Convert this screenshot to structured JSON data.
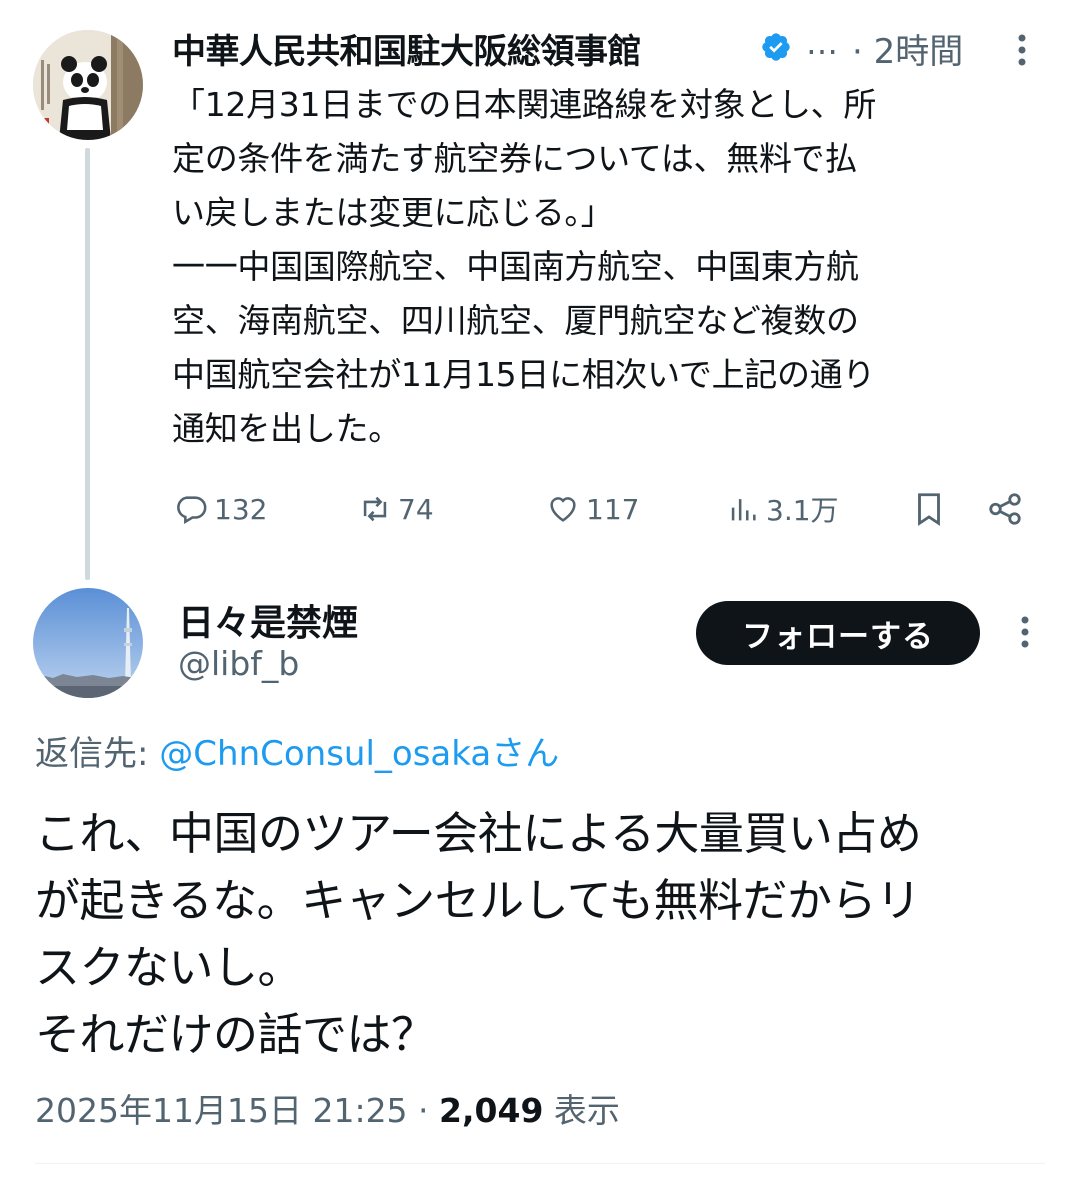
{
  "parent_tweet": {
    "author_name": "中華人民共和国駐大阪総領事館",
    "truncation": "…",
    "time": "· 2時間",
    "text": "「12月31日までの日本関連路線を対象とし、所\n定の条件を満たす航空券については、無料で払\nい戻しまたは変更に応じる。」\n一一中国国際航空、中国南方航空、中国東方航\n空、海南航空、四川航空、厦門航空など複数の\n中国航空会社が11月15日に相次いで上記の通り\n通知を出した。",
    "avatar_text": "中華人民共和国駐大阪総領事館",
    "stats": {
      "replies": "132",
      "retweets": "74",
      "likes": "117",
      "views": "3.1万"
    }
  },
  "reply_tweet": {
    "author_name": "日々是禁煙",
    "handle": "@libf_b",
    "follow_label": "フォローする",
    "reply_to_label": "返信先:",
    "reply_to_mention": "@ChnConsul_osakaさん",
    "text": "これ、中国のツアー会社による大量買い占め\nが起きるな。キャンセルしても無料だからリ\nスクないし。\nそれだけの話では？",
    "timestamp": "2025年11月15日 21:25 · ",
    "view_count": "2,049",
    "view_label": " 表示"
  },
  "colors": {
    "accent": "#1d9bf0",
    "text": "#0f1419",
    "secondary": "#536471",
    "button_bg": "#0f1419"
  }
}
